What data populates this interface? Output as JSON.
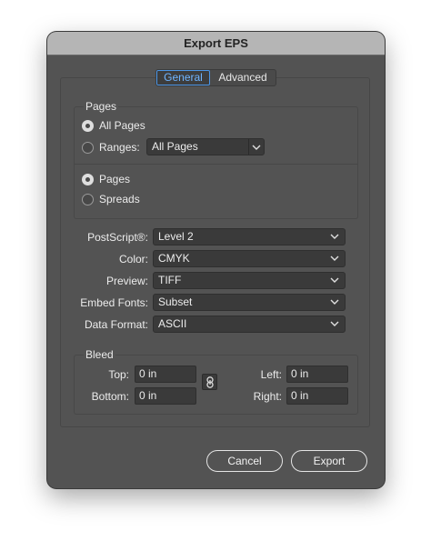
{
  "dialog": {
    "title": "Export EPS"
  },
  "tabs": [
    {
      "label": "General",
      "active": true
    },
    {
      "label": "Advanced",
      "active": false
    }
  ],
  "pages": {
    "group_title": "Pages",
    "all_pages_label": "All Pages",
    "all_pages_checked": true,
    "ranges_label": "Ranges:",
    "ranges_checked": false,
    "ranges_value": "All Pages",
    "pages_label": "Pages",
    "pages_checked": true,
    "spreads_label": "Spreads",
    "spreads_checked": false
  },
  "options": [
    {
      "label": "PostScript®:",
      "value": "Level 2"
    },
    {
      "label": "Color:",
      "value": "CMYK"
    },
    {
      "label": "Preview:",
      "value": "TIFF"
    },
    {
      "label": "Embed Fonts:",
      "value": "Subset"
    },
    {
      "label": "Data Format:",
      "value": "ASCII"
    }
  ],
  "bleed": {
    "group_title": "Bleed",
    "top_label": "Top:",
    "top_value": "0 in",
    "bottom_label": "Bottom:",
    "bottom_value": "0 in",
    "left_label": "Left:",
    "left_value": "0 in",
    "right_label": "Right:",
    "right_value": "0 in",
    "link_icon": "chain-link-icon"
  },
  "buttons": {
    "cancel": "Cancel",
    "export": "Export"
  },
  "colors": {
    "accent": "#4c96e6",
    "dialog_bg": "#535353",
    "titlebar_bg": "#b5b5b5"
  }
}
